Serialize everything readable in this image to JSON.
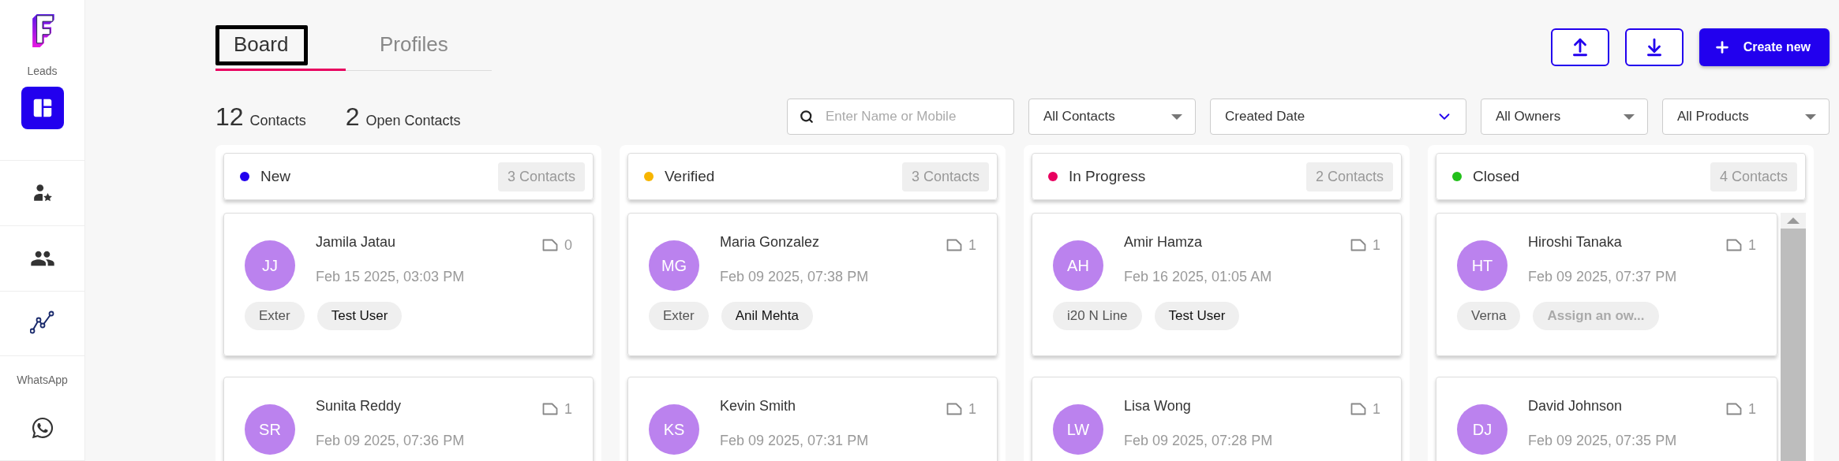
{
  "sidebar": {
    "sections": [
      {
        "label": "Leads",
        "items": [
          {
            "selected": true
          },
          {
            "selected": false
          },
          {
            "selected": false
          },
          {
            "selected": false
          }
        ]
      },
      {
        "label": "WhatsApp",
        "items": [
          {
            "selected": false
          }
        ]
      }
    ]
  },
  "tabs": [
    {
      "label": "Board",
      "selected": true,
      "focused": true
    },
    {
      "label": "Profiles",
      "selected": false,
      "focused": false
    }
  ],
  "stats": [
    {
      "value": "12",
      "label": "Contacts"
    },
    {
      "value": "2",
      "label": "Open Contacts"
    }
  ],
  "actions": [
    {
      "kind": "upload"
    },
    {
      "kind": "download"
    },
    {
      "kind": "create",
      "label": "Create new"
    }
  ],
  "search": {
    "placeholder": "Enter Name or Mobile"
  },
  "filters": [
    {
      "kind": "dropdown",
      "value": "All Contacts"
    },
    {
      "kind": "date",
      "value": "Created Date"
    },
    {
      "kind": "dropdown",
      "value": "All Owners"
    },
    {
      "kind": "dropdown",
      "value": "All Products"
    }
  ],
  "columns": [
    {
      "title": "New",
      "color": "#2200ee",
      "count": "3 Contacts",
      "scrollable": false,
      "cards": [
        {
          "initials": "JJ",
          "name": "Jamila Jatau",
          "notes": "0",
          "date": "Feb 15 2025, 03:03 PM",
          "tags": [
            {
              "label": "Exter",
              "kind": "product"
            },
            {
              "label": "Test User",
              "kind": "owner"
            }
          ]
        },
        {
          "initials": "SR",
          "name": "Sunita Reddy",
          "notes": "1",
          "date": "Feb 09 2025, 07:36 PM"
        }
      ]
    },
    {
      "title": "Verified",
      "color": "#f7b500",
      "count": "3 Contacts",
      "scrollable": false,
      "cards": [
        {
          "initials": "MG",
          "name": "Maria Gonzalez",
          "notes": "1",
          "date": "Feb 09 2025, 07:38 PM",
          "tags": [
            {
              "label": "Exter",
              "kind": "product"
            },
            {
              "label": "Anil Mehta",
              "kind": "owner"
            }
          ]
        },
        {
          "initials": "KS",
          "name": "Kevin Smith",
          "notes": "1",
          "date": "Feb 09 2025, 07:31 PM"
        }
      ]
    },
    {
      "title": "In Progress",
      "color": "#e8005f",
      "count": "2 Contacts",
      "scrollable": false,
      "cards": [
        {
          "initials": "AH",
          "name": "Amir Hamza",
          "notes": "1",
          "date": "Feb 16 2025, 01:05 AM",
          "tags": [
            {
              "label": "i20 N Line",
              "kind": "product"
            },
            {
              "label": "Test User",
              "kind": "owner"
            }
          ]
        },
        {
          "initials": "LW",
          "name": "Lisa Wong",
          "notes": "1",
          "date": "Feb 09 2025, 07:28 PM"
        }
      ]
    },
    {
      "title": "Closed",
      "color": "#22c01a",
      "count": "4 Contacts",
      "scrollable": true,
      "cards": [
        {
          "initials": "HT",
          "name": "Hiroshi Tanaka",
          "notes": "1",
          "date": "Feb 09 2025, 07:37 PM",
          "tags": [
            {
              "label": "Verna",
              "kind": "product"
            },
            {
              "label": "Assign an ow...",
              "kind": "unassigned"
            }
          ]
        },
        {
          "initials": "DJ",
          "name": "David Johnson",
          "notes": "1",
          "date": "Feb 09 2025, 07:35 PM"
        }
      ]
    }
  ]
}
